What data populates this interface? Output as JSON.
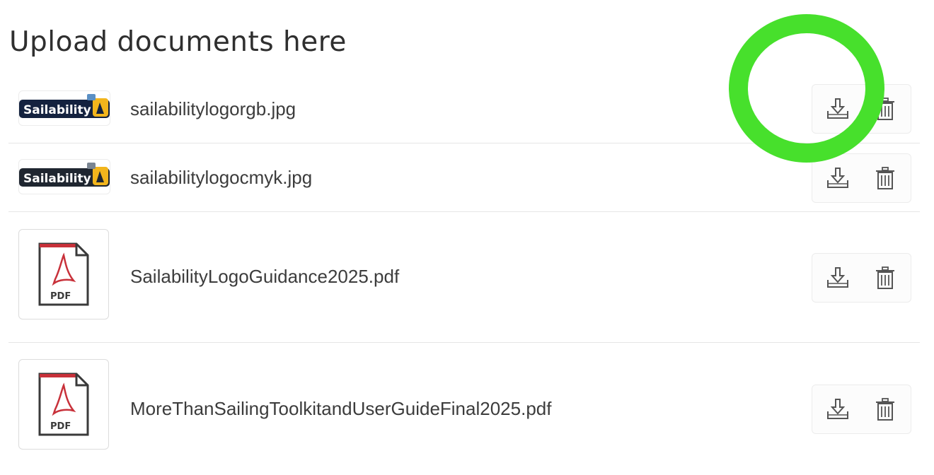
{
  "page": {
    "title": "Upload documents here"
  },
  "documents": [
    {
      "filename": "sailabilitylogorgb.jpg",
      "thumb_type": "image-logo",
      "thumb_text": "Sailability"
    },
    {
      "filename": "sailabilitylogocmyk.jpg",
      "thumb_type": "image-logo",
      "thumb_text": "Sailability"
    },
    {
      "filename": "SailabilityLogoGuidance2025.pdf",
      "thumb_type": "pdf",
      "thumb_text": "PDF"
    },
    {
      "filename": "MoreThanSailingToolkitandUserGuideFinal2025.pdf",
      "thumb_type": "pdf",
      "thumb_text": "PDF"
    }
  ],
  "icons": {
    "download": "download-icon",
    "delete": "trash-icon",
    "file": "pdf-file-icon"
  },
  "colors": {
    "highlight_ring": "#47e02c",
    "logo_navy": "#14223f",
    "logo_yellow": "#f2b51c",
    "pdf_red": "#c8313a"
  }
}
